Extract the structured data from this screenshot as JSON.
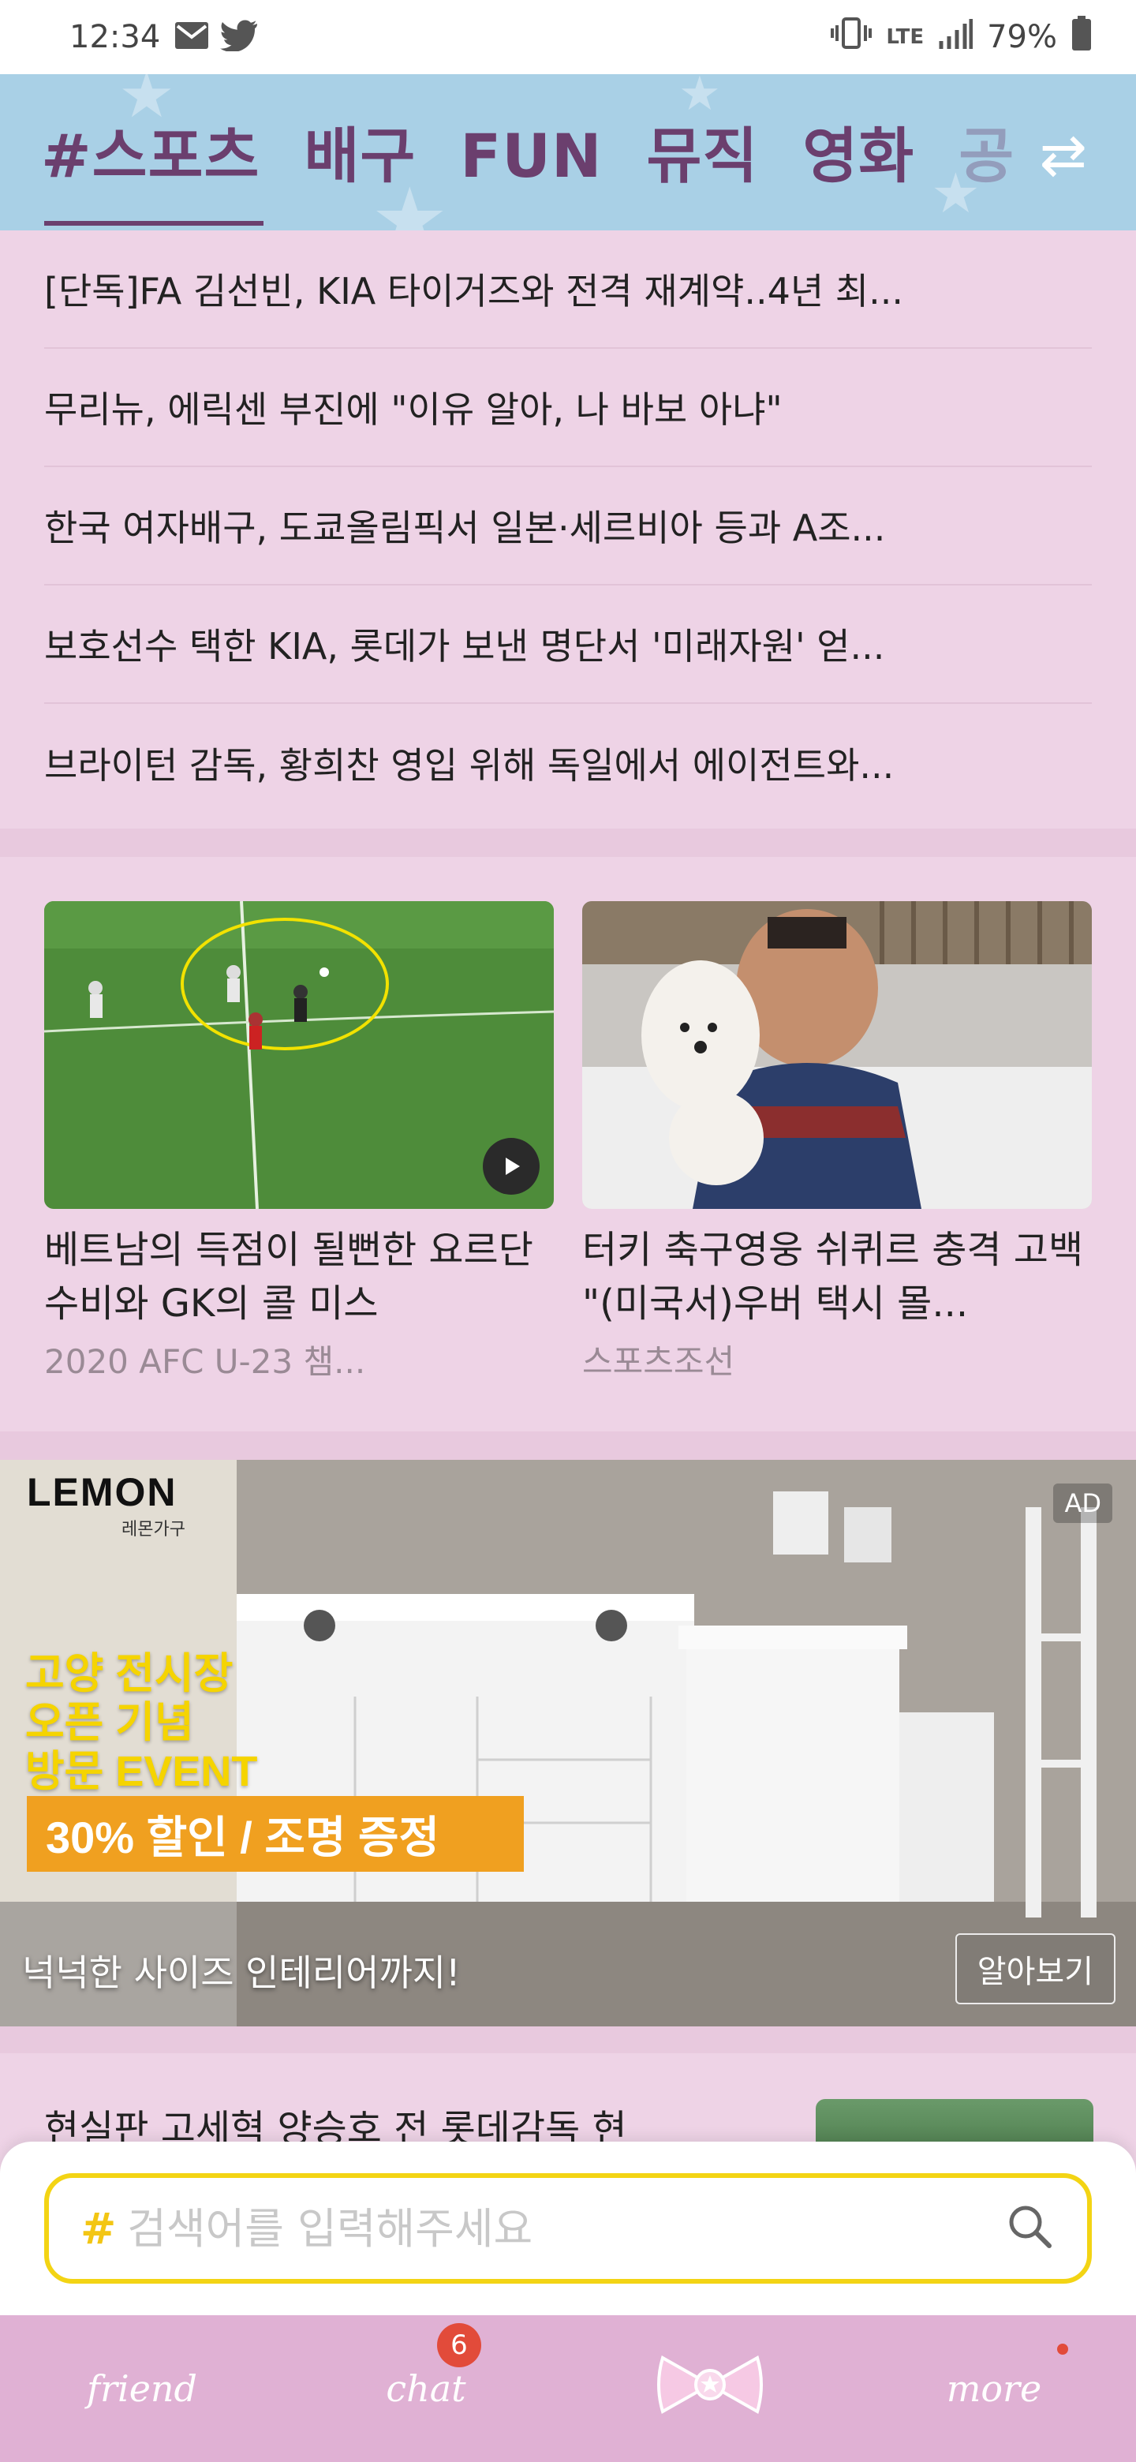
{
  "status_bar": {
    "time": "12:34",
    "network": "LTE",
    "battery": "79%"
  },
  "tabs": {
    "items": [
      "#스포츠",
      "배구",
      "FUN",
      "뮤직",
      "영화",
      "공"
    ],
    "active": "#스포츠"
  },
  "headlines": [
    "[단독]FA 김선빈, KIA 타이거즈와 전격 재계약..4년 최...",
    "무리뉴, 에릭센 부진에 \"이유 알아, 나 바보 아냐\"",
    "한국 여자배구, 도쿄올림픽서 일본·세르비아 등과 A조...",
    "보호선수 택한 KIA, 롯데가 보낸 명단서 '미래자원' 얻...",
    "브라이턴 감독, 황희찬 영입 위해 독일에서 에이전트와..."
  ],
  "cards": [
    {
      "title": "베트남의 득점이 될뻔한 요르단 수비와 GK의 콜 미스",
      "source": "2020 AFC U-23 챔..."
    },
    {
      "title": "터키 축구영웅 쉬퀴르 충격 고백 \"(미국서)우버 택시 몰...",
      "source": "스포츠조선"
    }
  ],
  "ad": {
    "badge": "AD",
    "brand": "LEMON",
    "brand_sub": "레몬가구",
    "promo_lines": [
      "고양 전시장",
      "오픈 기념",
      "방문 EVENT"
    ],
    "discount": "30% 할인 / 조명 증정",
    "caption": "넉넉한 사이즈 인테리어까지!",
    "cta": "알아보기"
  },
  "next_article": {
    "title": "현실판 고세혁 양승호 전 롯데감독 현"
  },
  "search": {
    "hash": "#",
    "placeholder": "검색어를 입력해주세요"
  },
  "bottom_nav": {
    "items": [
      "friend",
      "chat",
      "",
      "more"
    ],
    "chat_badge": "6"
  },
  "colors": {
    "tab_bg": "#a9d0e6",
    "tab_text": "#6b3f6e",
    "content_bg": "#eed3e6",
    "nav_bg": "#e0b1d4",
    "search_border": "#f3d414",
    "badge": "#e24b3a"
  }
}
